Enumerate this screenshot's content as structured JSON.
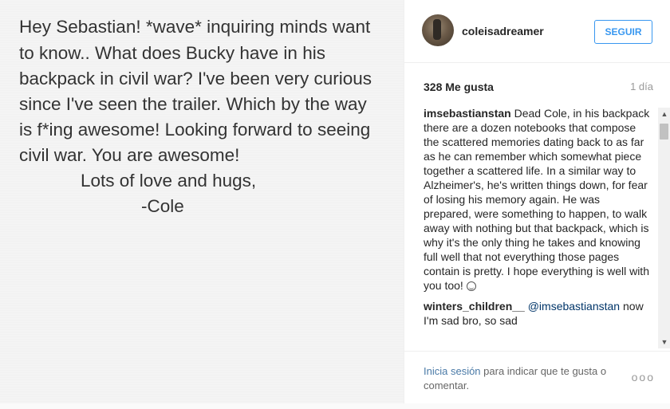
{
  "note": {
    "lines": [
      "Hey Sebastian! *wave* inquiring minds want",
      "to know.. What does Bucky have in his",
      "backpack in civil war? I've been very curious",
      "since I've seen the trailer. Which by the way",
      "is f*ing awesome! Looking forward to seeing",
      "civil war. You are awesome!",
      "Lots of love and hugs,",
      "-Cole"
    ]
  },
  "header": {
    "username": "coleisadreamer",
    "follow_label": "SEGUIR"
  },
  "meta": {
    "likes": "328 Me gusta",
    "time": "1 día"
  },
  "comments": [
    {
      "user": "imsebastianstan",
      "text": "Dead Cole, in his backpack there are a dozen notebooks that compose the scattered memories dating back to as far as he can remember which somewhat piece together a scattered life. In a similar way to Alzheimer's, he's written things down, for fear of losing his memory again. He was prepared, were something to happen, to walk away with nothing but that backpack, which is why it's the only thing he takes and knowing full well that not everything those pages contain is pretty. I hope everything is well with you too!"
    },
    {
      "user": "winters_children__",
      "mention": "@imsebastianstan",
      "text": "now I'm sad bro, so sad"
    }
  ],
  "footer": {
    "login_link": "Inicia sesión",
    "login_text": " para indicar que te gusta o comentar.",
    "more": "ooo"
  },
  "icons": {
    "smiley": "smiley-icon",
    "more": "more-options-icon"
  }
}
